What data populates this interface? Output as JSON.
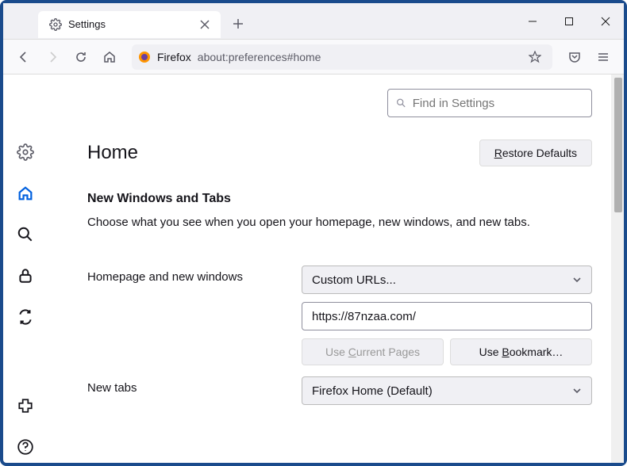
{
  "tab": {
    "title": "Settings"
  },
  "urlbar": {
    "prefix": "Firefox",
    "path": "about:preferences#home"
  },
  "search": {
    "placeholder": "Find in Settings"
  },
  "page": {
    "title": "Home",
    "restore_label": "Restore Defaults",
    "restore_accel": "R"
  },
  "section": {
    "title": "New Windows and Tabs",
    "desc": "Choose what you see when you open your homepage, new windows, and new tabs."
  },
  "homepage": {
    "label": "Homepage and new windows",
    "select_value": "Custom URLs...",
    "url_value": "https://87nzaa.com/",
    "use_current_label": "Use Current Pages",
    "use_current_accel": "C",
    "use_bookmark_label": "Use Bookmark…",
    "use_bookmark_accel": "B"
  },
  "newtabs": {
    "label": "New tabs",
    "select_value": "Firefox Home (Default)"
  }
}
